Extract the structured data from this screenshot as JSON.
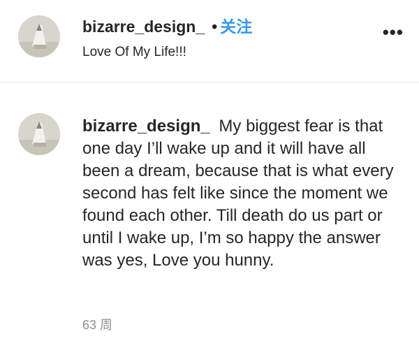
{
  "header": {
    "username": "bizarre_design_",
    "separator": "•",
    "follow_label": "关注",
    "subtitle": "Love Of My Life!!!",
    "more_icon": "more-horizontal-icon",
    "more_glyph": "•••"
  },
  "comment": {
    "username": "bizarre_design_",
    "text": "My biggest fear is that one day I’ll wake up and it will have all been a dream, because that is what every second has felt like since the moment we found each other. Till death do us part or until I wake up, I’m so happy the answer was yes, Love you hunny.",
    "timestamp": "63 周"
  },
  "colors": {
    "link": "#3897f0",
    "text": "#262626",
    "muted": "#8e8e8e",
    "divider": "#e6e6e6"
  }
}
